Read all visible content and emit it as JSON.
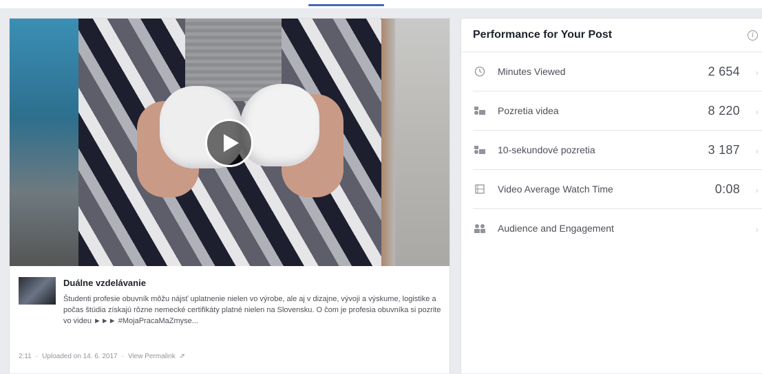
{
  "video": {
    "play_icon": "play-icon"
  },
  "post": {
    "title": "Duálne vzdelávanie",
    "description": "Študenti profesie obuvník môžu nájsť uplatnenie nielen vo výrobe, ale aj v dizajne, vývoji a výskume, logistike a počas štúdia získajú rôzne nemecké certifikáty platné nielen na Slovensku. O čom je profesia obuvníka si pozrite vo videu ►►► #MojaPracaMaZmyse...",
    "duration": "2:11",
    "uploaded": "Uploaded on 14. 6. 2017",
    "permalink_label": "View Permalink"
  },
  "panel": {
    "title": "Performance for Your Post",
    "metrics": [
      {
        "label": "Minutes Viewed",
        "value": "2 654",
        "icon": "clock-icon"
      },
      {
        "label": "Pozretia videa",
        "value": "8 220",
        "icon": "video-views-icon"
      },
      {
        "label": "10-sekundové pozretia",
        "value": "3 187",
        "icon": "video-views-icon"
      },
      {
        "label": "Video Average Watch Time",
        "value": "0:08",
        "icon": "film-icon"
      },
      {
        "label": "Audience and Engagement",
        "value": "",
        "icon": "people-icon"
      }
    ]
  },
  "colors": {
    "accent": "#4267b2",
    "background": "#e9ebee",
    "text": "#1d2129",
    "muted": "#90949c"
  }
}
